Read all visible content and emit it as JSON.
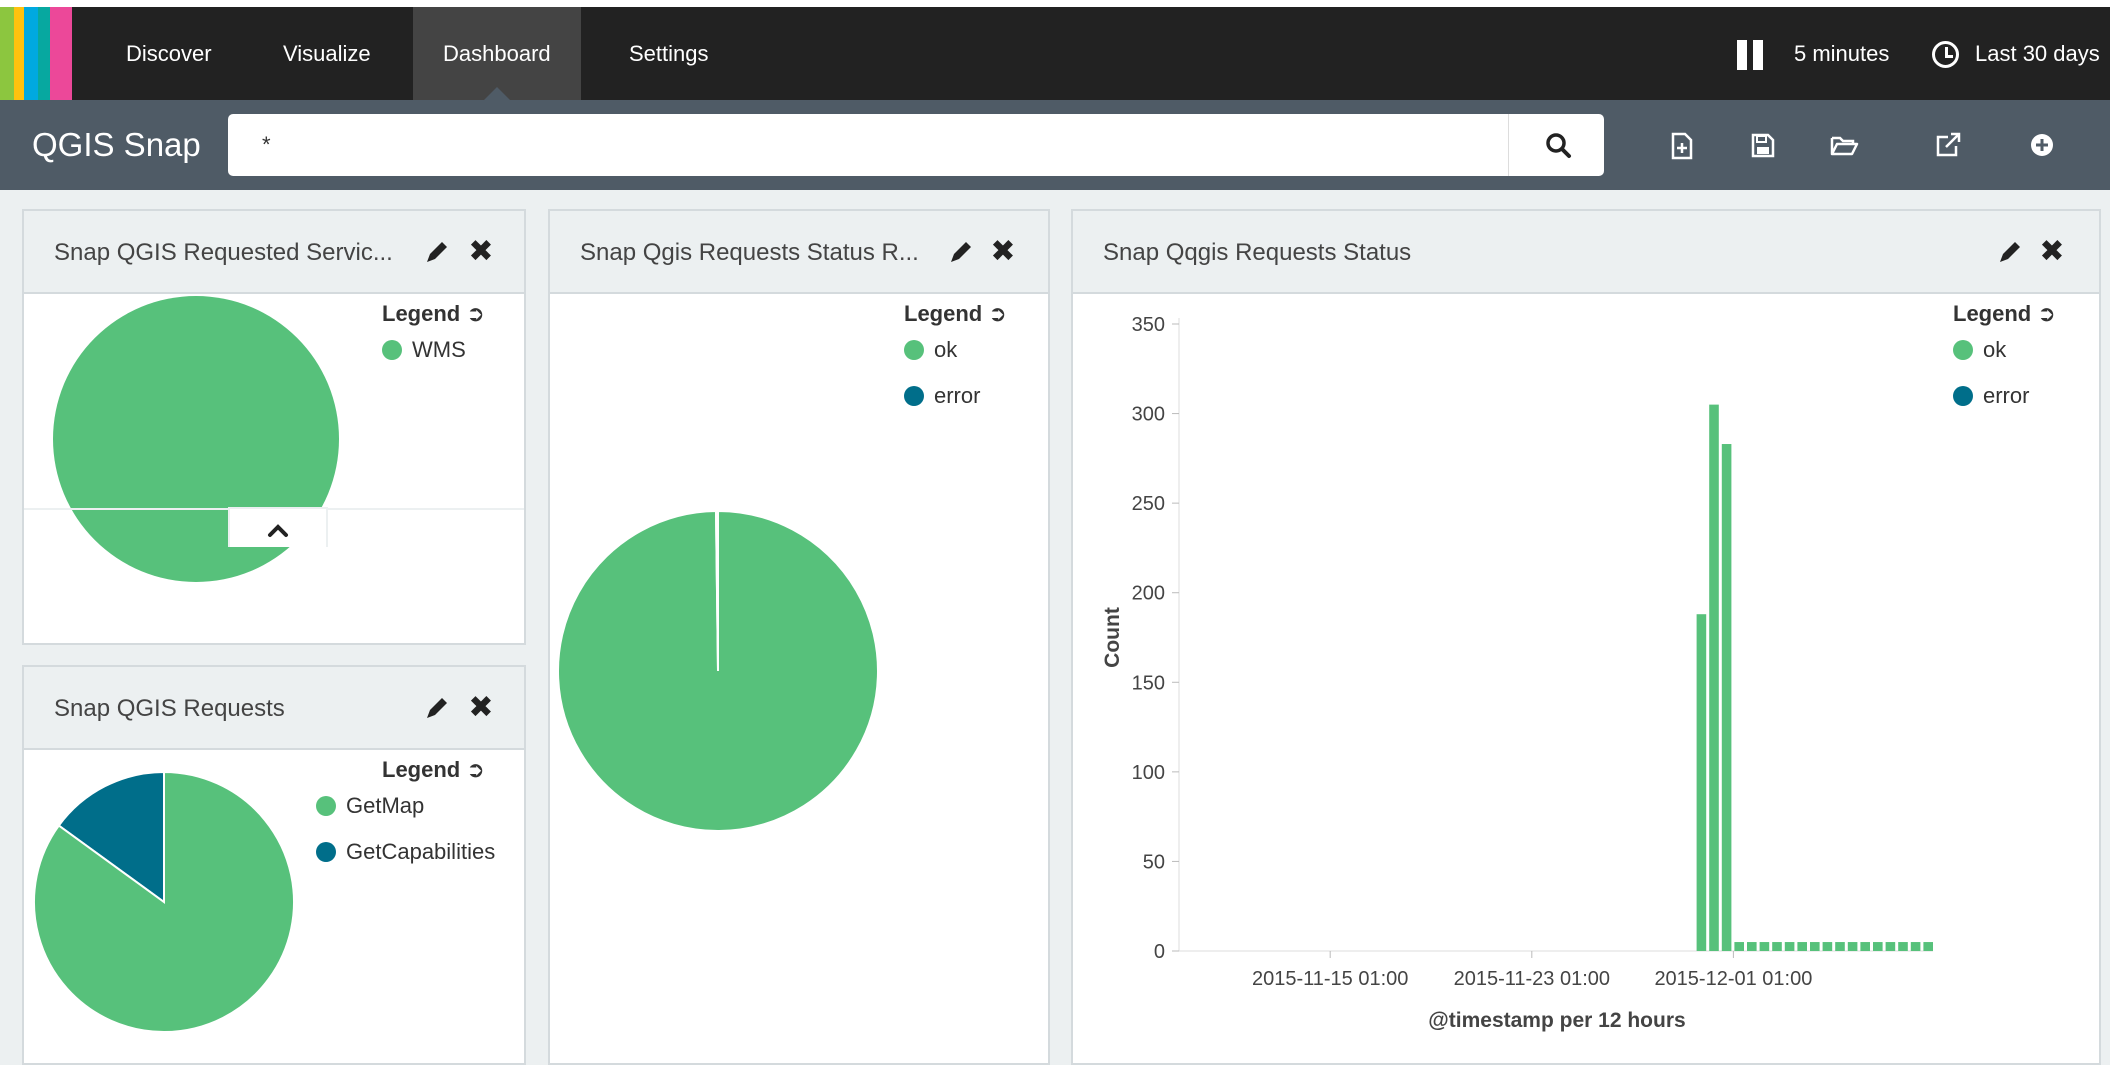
{
  "header": {
    "logo_colors": [
      "#8cc63f",
      "#ffc20e",
      "#00a9e0",
      "#07a8a0",
      "#ec4899"
    ],
    "nav_tabs": [
      {
        "label": "Discover",
        "active": false
      },
      {
        "label": "Visualize",
        "active": false
      },
      {
        "label": "Dashboard",
        "active": true
      },
      {
        "label": "Settings",
        "active": false
      }
    ],
    "refresh_interval": "5 minutes",
    "time_range": "Last 30 days"
  },
  "search": {
    "app_title": "QGIS Snap",
    "query": "*"
  },
  "toolbar": {
    "icons": [
      "new-dashboard-icon",
      "save-icon",
      "open-icon",
      "share-icon",
      "add-panel-icon"
    ]
  },
  "colors": {
    "ok": "#57c17b",
    "error": "#006e8a"
  },
  "panels": {
    "services": {
      "title": "Snap QGIS Requested Servic...",
      "legend_title": "Legend",
      "legend": [
        {
          "label": "WMS",
          "color": "#57c17b"
        }
      ]
    },
    "requests": {
      "title": "Snap QGIS Requests",
      "legend_title": "Legend",
      "legend": [
        {
          "label": "GetMap",
          "color": "#57c17b"
        },
        {
          "label": "GetCapabilities",
          "color": "#006e8a"
        }
      ]
    },
    "status_ratio": {
      "title": "Snap Qgis Requests Status R...",
      "legend_title": "Legend",
      "legend": [
        {
          "label": "ok",
          "color": "#57c17b"
        },
        {
          "label": "error",
          "color": "#006e8a"
        }
      ]
    },
    "status": {
      "title": "Snap Qqgis Requests Status",
      "legend_title": "Legend",
      "legend": [
        {
          "label": "ok",
          "color": "#57c17b"
        },
        {
          "label": "error",
          "color": "#006e8a"
        }
      ]
    }
  },
  "chart_data": [
    {
      "type": "pie",
      "labels": [
        "WMS"
      ],
      "values": [
        100
      ]
    },
    {
      "type": "pie",
      "labels": [
        "GetMap",
        "GetCapabilities"
      ],
      "values": [
        85,
        15
      ]
    },
    {
      "type": "pie",
      "labels": [
        "ok",
        "error"
      ],
      "values": [
        99.8,
        0.2
      ]
    },
    {
      "type": "bar",
      "xlabel": "@timestamp per 12 hours",
      "ylabel": "Count",
      "ylim": [
        0,
        350
      ],
      "yticks": [
        0,
        50,
        100,
        150,
        200,
        250,
        300,
        350
      ],
      "xticks": [
        "2015-11-15 01:00",
        "2015-11-23 01:00",
        "2015-12-01 01:00"
      ],
      "x_start": "2015-11-09 01:00",
      "x_end": "2015-12-09 01:00",
      "interval": "12h",
      "series": [
        {
          "name": "ok",
          "bars": [
            {
              "t": "2015-11-29 13:00",
              "value": 188
            },
            {
              "t": "2015-11-30 01:00",
              "value": 305
            },
            {
              "t": "2015-11-30 13:00",
              "value": 283
            },
            {
              "t": "2015-12-01 01:00",
              "value": 5
            },
            {
              "t": "2015-12-01 13:00",
              "value": 5
            },
            {
              "t": "2015-12-02 01:00",
              "value": 5
            },
            {
              "t": "2015-12-02 13:00",
              "value": 5
            },
            {
              "t": "2015-12-03 01:00",
              "value": 5
            },
            {
              "t": "2015-12-03 13:00",
              "value": 5
            },
            {
              "t": "2015-12-04 01:00",
              "value": 5
            },
            {
              "t": "2015-12-04 13:00",
              "value": 5
            },
            {
              "t": "2015-12-05 01:00",
              "value": 5
            },
            {
              "t": "2015-12-05 13:00",
              "value": 5
            },
            {
              "t": "2015-12-06 01:00",
              "value": 5
            },
            {
              "t": "2015-12-06 13:00",
              "value": 5
            },
            {
              "t": "2015-12-07 01:00",
              "value": 5
            },
            {
              "t": "2015-12-07 13:00",
              "value": 5
            },
            {
              "t": "2015-12-08 01:00",
              "value": 5
            },
            {
              "t": "2015-12-08 13:00",
              "value": 5
            }
          ]
        }
      ]
    }
  ]
}
